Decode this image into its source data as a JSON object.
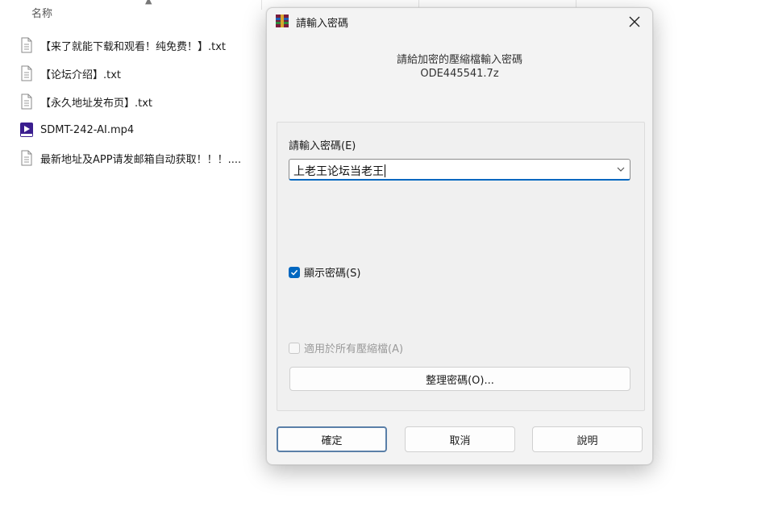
{
  "explorer": {
    "column_header": "名称",
    "files": [
      {
        "name": "【来了就能下载和观看！纯免费！】.txt",
        "icon": "text-file-icon"
      },
      {
        "name": "【论坛介绍】.txt",
        "icon": "text-file-icon"
      },
      {
        "name": "【永久地址发布页】.txt",
        "icon": "text-file-icon"
      },
      {
        "name": "SDMT-242-AI.mp4",
        "icon": "video-file-icon"
      },
      {
        "name": "最新地址及APP请发邮箱自动获取！！！....",
        "icon": "text-file-icon"
      }
    ]
  },
  "dialog": {
    "title": "請輸入密碼",
    "prompt_line1": "請給加密的壓縮檔輸入密碼",
    "prompt_line2": "ODE445541.7z",
    "password_label": "請輸入密碼(E)",
    "password_value": "上老王论坛当老王",
    "show_password": {
      "label": "顯示密碼(S)",
      "checked": true
    },
    "apply_all": {
      "label": "適用於所有壓縮檔(A)",
      "checked": false,
      "enabled": false
    },
    "organize_button": "整理密碼(O)...",
    "ok_button": "確定",
    "cancel_button": "取消",
    "help_button": "說明"
  }
}
